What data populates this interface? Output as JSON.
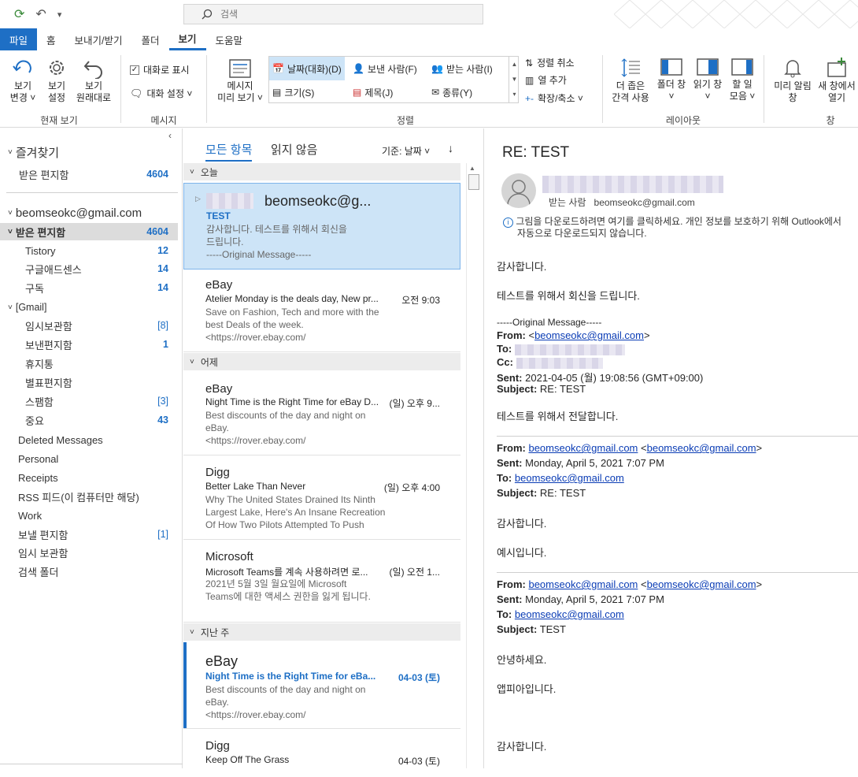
{
  "search": {
    "placeholder": "검색"
  },
  "tabs": [
    "파일",
    "홈",
    "보내기/받기",
    "폴더",
    "보기",
    "도움말"
  ],
  "ribbon": {
    "current_view": {
      "change_view": [
        "보기",
        "변경 ˅"
      ],
      "view_settings": [
        "보기",
        "설정"
      ],
      "reset_view": [
        "보기",
        "원래대로"
      ],
      "label": "현재 보기"
    },
    "messages": {
      "show_as_conversations": "대화로 표시",
      "conversation_settings": "대화 설정 ˅",
      "label": "메시지"
    },
    "message_preview": [
      "메시지",
      "미리 보기 ˅"
    ],
    "arrangement": {
      "date": "날짜(대화)(D)",
      "from": "보낸 사람(F)",
      "to": "받는 사람(I)",
      "size": "크기(S)",
      "subject": "제목(J)",
      "type": "종류(Y)",
      "reverse_sort": "정렬 취소",
      "add_columns": "열 추가",
      "expand_collapse": "확장/축소 ˅",
      "label": "정렬"
    },
    "layout": {
      "compact": [
        "더 좁은",
        "간격 사용"
      ],
      "folder_pane": [
        "폴더 창",
        "˅"
      ],
      "reading_pane": [
        "읽기 창",
        "˅"
      ],
      "todo_bar": [
        "할 일",
        "모음 ˅"
      ],
      "label": "레이아웃"
    },
    "window": {
      "reminders": [
        "미리 알림",
        "창"
      ],
      "open_new": [
        "새 창에서",
        "열기"
      ],
      "label": "창"
    }
  },
  "folders": {
    "favorites_label": "즐겨찾기",
    "favorites": [
      {
        "name": "받은 편지함",
        "count": "4604"
      }
    ],
    "account": "beomseokc@gmail.com",
    "inbox": {
      "name": "받은 편지함",
      "count": "4604"
    },
    "inbox_children": [
      {
        "name": "Tistory",
        "count": "12"
      },
      {
        "name": "구글애드센스",
        "count": "14"
      },
      {
        "name": "구독",
        "count": "14"
      }
    ],
    "gmail_label": "[Gmail]",
    "gmail_children": [
      {
        "name": "임시보관함",
        "count": "[8]"
      },
      {
        "name": "보낸편지함",
        "count": "1"
      },
      {
        "name": "휴지통",
        "count": ""
      },
      {
        "name": "별표편지함",
        "count": ""
      },
      {
        "name": "스팸함",
        "count": "[3]"
      },
      {
        "name": "중요",
        "count": "43"
      }
    ],
    "other": [
      {
        "name": "Deleted Messages",
        "count": ""
      },
      {
        "name": "Personal",
        "count": ""
      },
      {
        "name": "Receipts",
        "count": ""
      },
      {
        "name": "RSS 피드(이 컴퓨터만 해당)",
        "count": ""
      },
      {
        "name": "Work",
        "count": ""
      },
      {
        "name": "보낼 편지함",
        "count": "[1]"
      },
      {
        "name": "임시 보관함",
        "count": ""
      },
      {
        "name": "검색 폴더",
        "count": ""
      }
    ]
  },
  "list": {
    "filter_all": "모든 항목",
    "filter_unread": "읽지 않음",
    "sort_by": "기준: 날짜 ˅",
    "groups": {
      "today": "오늘",
      "yesterday": "어제",
      "last_week": "지난 주"
    },
    "messages": [
      {
        "from": "beomseokc@g...",
        "subject": "TEST",
        "time": "",
        "preview": [
          "감사합니다.   테스트를 위해서 회신을",
          "드립니다.",
          "-----Original Message-----"
        ]
      },
      {
        "from": "eBay",
        "subject": "Atelier Monday is the deals day, New pr...",
        "time": "오전 9:03",
        "preview": [
          "Save on Fashion, Tech and more with the",
          "best Deals of the week.",
          " <https://rover.ebay.com/"
        ]
      },
      {
        "from": "eBay",
        "subject": "Night Time is the Right Time for eBay D...",
        "time": "(일) 오후 9...",
        "preview": [
          "Best discounts of the day and night on",
          "eBay.",
          " <https://rover.ebay.com/"
        ]
      },
      {
        "from": "Digg",
        "subject": "Better Lake Than Never",
        "time": "(일) 오후 4:00",
        "preview": [
          "Why The United States Drained Its Ninth",
          "Largest Lake, Here's An Insane Recreation",
          "Of How Two Pilots Attempted To Push"
        ]
      },
      {
        "from": "Microsoft",
        "subject": "Microsoft Teams를 계속 사용하려면 로...",
        "time": "(일) 오전 1...",
        "preview": [
          "2021년 5월 3일 월요일에 Microsoft",
          "Teams에 대한 액세스 권한을 잃게 됩니다."
        ]
      },
      {
        "from": "eBay",
        "subject": "Night Time is the Right Time for eBa...",
        "time": "04-03 (토)",
        "preview": [
          "Best discounts of the day and night on",
          "eBay.",
          " <https://rover.ebay.com/"
        ]
      },
      {
        "from": "Digg",
        "subject": "Keep Off The Grass",
        "time": "04-03 (토)",
        "preview": []
      }
    ]
  },
  "reading": {
    "subject": "RE: TEST",
    "to_label": "받는 사람",
    "to_address": "beomseokc@gmail.com",
    "info_bar": [
      "그림을 다운로드하려면 여기를 클릭하세요. 개인 정보를 보호하기 위해 Outlook에서",
      "자동으로 다운로드되지 않습니다."
    ],
    "body": {
      "p1": "감사합니다.",
      "p2": "테스트를 위해서 회신을 드립니다.",
      "orig": "-----Original Message-----",
      "from_label": "From:",
      "from_pre": "<",
      "from_link": "beomseokc@gmail.com",
      "from_post": ">",
      "to_label": "To:",
      "cc_label": "Cc:",
      "sent_label": "Sent:",
      "sent_value": "2021-04-05 (월) 19:08:56 (GMT+09:00)",
      "subject_label": "Subject:",
      "subject_value": "RE: TEST",
      "p3": "테스트를 위해서 전달합니다.",
      "q1_from_label": "From:",
      "q1_from_link": "beomseokc@gmail.com",
      "q1_from_pre": " <",
      "q1_from_link2": "beomseokc@gmail.com",
      "q1_from_post": ">",
      "q1_sent_label": "Sent:",
      "q1_sent_value": "Monday, April 5, 2021 7:07 PM",
      "q1_to_label": "To:",
      "q1_to_link": "beomseokc@gmail.com",
      "q1_subject_label": "Subject:",
      "q1_subject_value": "RE: TEST",
      "p4": "감사합니다.",
      "p5": "예시입니다.",
      "q2_from_label": "From:",
      "q2_from_link": "beomseokc@gmail.com",
      "q2_from_pre": " <",
      "q2_from_link2": "beomseokc@gmail.com",
      "q2_from_post": ">",
      "q2_sent_label": "Sent:",
      "q2_sent_value": "Monday, April 5, 2021 7:07 PM",
      "q2_to_label": "To:",
      "q2_to_link": "beomseokc@gmail.com",
      "q2_subject_label": "Subject:",
      "q2_subject_value": "TEST",
      "p6": "안녕하세요.",
      "p7": "앱피아입니다.",
      "p8": "감사합니다."
    }
  },
  "colors": {
    "accent": "#1e6fc5",
    "selected": "#cde4f7",
    "link": "#0a3cb5"
  }
}
